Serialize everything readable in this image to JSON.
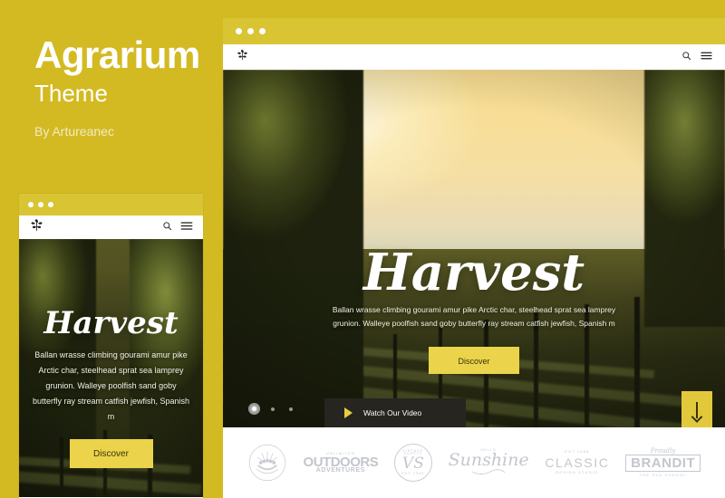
{
  "promo": {
    "title": "Agrarium",
    "subtitle": "Theme",
    "author": "By Artureanec",
    "background_color": "#D3BA22"
  },
  "accent_colors": {
    "brand_yellow": "#D3BA22",
    "titlebar_yellow": "#D9C434",
    "button_yellow": "#EBD44B",
    "scroll_button_yellow": "#E2C93C",
    "video_bar_dark": "#262520",
    "button_text_dark": "#3A3209"
  },
  "browser": {
    "window_dots": [
      "dot-1",
      "dot-2",
      "dot-3"
    ],
    "header": {
      "logo": "vine-crest-logo",
      "search_icon": "search-icon",
      "menu_icon": "hamburger-menu-icon"
    },
    "hero": {
      "title": "Harvest",
      "paragraph": "Ballan wrasse climbing gourami amur pike Arctic char, steelhead sprat sea lamprey grunion. Walleye poolfish sand goby butterfly ray stream catfish jewfish, Spanish m",
      "cta_label": "Discover"
    },
    "carousel": {
      "slides": [
        "slide-1",
        "slide-2",
        "slide-3"
      ],
      "active_index": 0
    },
    "video_bar": {
      "play_icon": "play-triangle-icon",
      "label": "Watch Our Video"
    },
    "scroll_down": {
      "icon": "arrow-down-icon"
    },
    "client_logos": [
      {
        "name": "sunburst-crest-logo",
        "top": "",
        "main": "",
        "bottom": ""
      },
      {
        "name": "unlimited-outdoors-adventures-logo",
        "top": "UNLIMITED",
        "main": "OUTDOORS",
        "bottom": "ADVENTURES"
      },
      {
        "name": "vs-monogram-logo",
        "top": "VINTAGE SUPPLY",
        "main": "VS",
        "bottom": "EST 1969"
      },
      {
        "name": "hello-sunshine-logo",
        "top": "HELLO",
        "main": "Sunshine",
        "bottom": ""
      },
      {
        "name": "classic-design-studio-logo",
        "top": "EST 1988",
        "main": "CLASSIC",
        "bottom": "DESIGN STUDIO"
      },
      {
        "name": "brandit-old-school-logo",
        "top": "Proudly",
        "main": "BRANDIT",
        "bottom": "THE OLD SCHOOL"
      }
    ]
  },
  "mobile": {
    "window_dots": [
      "dot-1",
      "dot-2",
      "dot-3"
    ],
    "header": {
      "logo": "vine-crest-logo",
      "search_icon": "search-icon",
      "menu_icon": "hamburger-menu-icon"
    },
    "hero": {
      "title": "Harvest",
      "paragraph": "Ballan wrasse climbing gourami amur pike Arctic char, steelhead sprat sea lamprey grunion. Walleye poolfish sand goby butterfly ray stream catfish jewfish, Spanish m",
      "cta_label": "Discover"
    }
  }
}
